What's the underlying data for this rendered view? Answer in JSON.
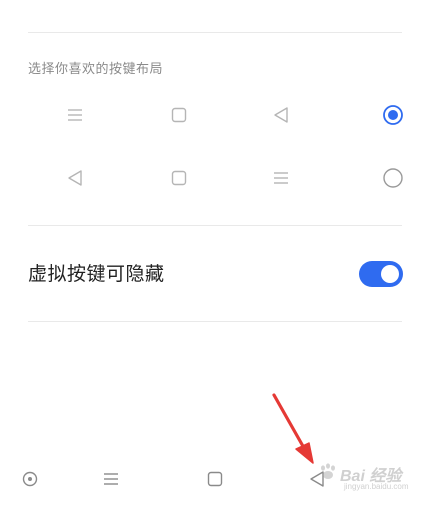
{
  "section": {
    "label": "选择你喜欢的按键布局"
  },
  "layouts": [
    {
      "buttons": [
        "menu-icon",
        "square-icon",
        "back-triangle-icon"
      ],
      "selected": true
    },
    {
      "buttons": [
        "back-triangle-icon",
        "square-icon",
        "menu-icon"
      ],
      "selected": false
    }
  ],
  "toggle": {
    "label": "虚拟按键可隐藏",
    "checked": true,
    "color": "#2f6bf0"
  },
  "navbar": {
    "buttons": [
      "circle-dot-icon",
      "menu-icon",
      "square-icon",
      "back-triangle-icon"
    ]
  },
  "annotation": {
    "arrow_color": "#e53935"
  },
  "watermark": {
    "brand": "Bai 经验",
    "sub": "jingyan.baidu.com"
  },
  "colors": {
    "accent": "#2f6bf0",
    "icon_gray": "#b5b5b5",
    "divider": "#e9e9e9"
  }
}
